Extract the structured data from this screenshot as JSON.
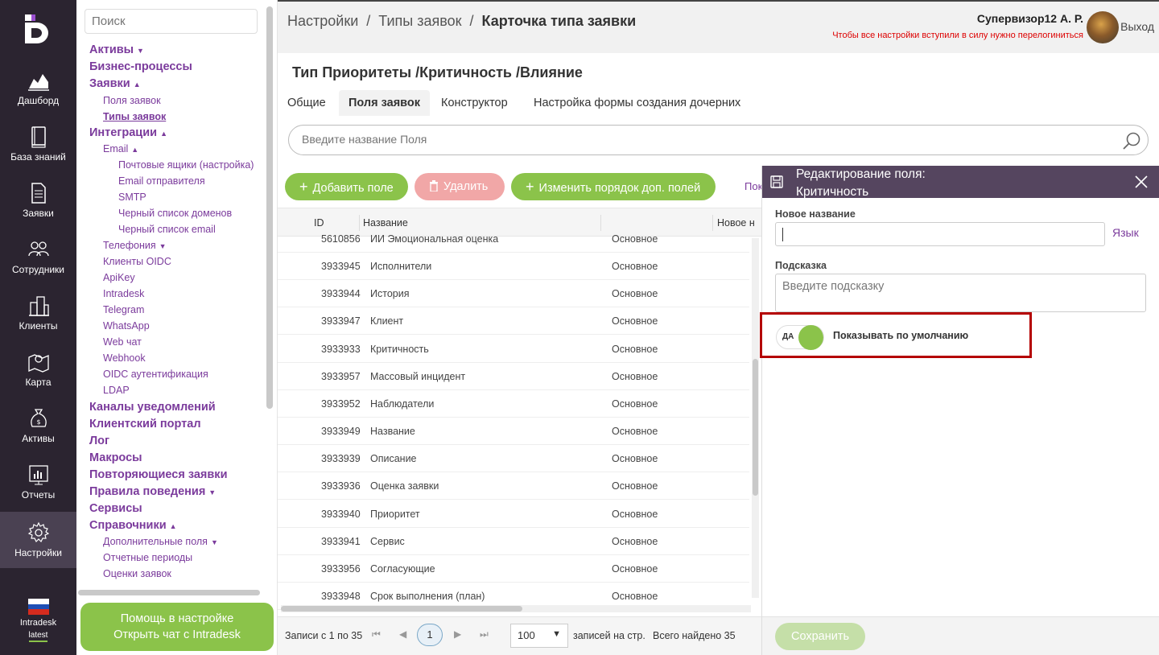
{
  "rail": {
    "items": [
      {
        "label": "Дашборд",
        "icon": "dashboard-icon"
      },
      {
        "label": "База знаний",
        "icon": "book-icon"
      },
      {
        "label": "Заявки",
        "icon": "document-icon"
      },
      {
        "label": "Сотрудники",
        "icon": "people-icon"
      },
      {
        "label": "Клиенты",
        "icon": "buildings-icon"
      },
      {
        "label": "Карта",
        "icon": "map-icon"
      },
      {
        "label": "Активы",
        "icon": "money-bag-icon"
      },
      {
        "label": "Отчеты",
        "icon": "report-icon"
      },
      {
        "label": "Настройки",
        "icon": "gear-icon"
      }
    ],
    "brand": "Intradesk",
    "version": "latest"
  },
  "sidebar": {
    "search_placeholder": "Поиск",
    "tree": [
      {
        "label": "Активы",
        "caret": "▼"
      },
      {
        "label": "Бизнес-процессы",
        "caret": ""
      },
      {
        "label": "Заявки",
        "caret": "▲"
      },
      {
        "label": "Поля заявок",
        "caret": ""
      },
      {
        "label": "Типы заявок",
        "caret": ""
      },
      {
        "label": "Интеграции",
        "caret": "▲"
      },
      {
        "label": "Email",
        "caret": "▲"
      },
      {
        "label": "Почтовые ящики (настройка)",
        "caret": ""
      },
      {
        "label": "Email отправителя",
        "caret": ""
      },
      {
        "label": "SMTP",
        "caret": ""
      },
      {
        "label": "Черный список доменов",
        "caret": ""
      },
      {
        "label": "Черный список email",
        "caret": ""
      },
      {
        "label": "Телефония",
        "caret": "▼"
      },
      {
        "label": "Клиенты OIDC",
        "caret": ""
      },
      {
        "label": "ApiKey",
        "caret": ""
      },
      {
        "label": "Intradesk",
        "caret": ""
      },
      {
        "label": "Telegram",
        "caret": ""
      },
      {
        "label": "WhatsApp",
        "caret": ""
      },
      {
        "label": "Web чат",
        "caret": ""
      },
      {
        "label": "Webhook",
        "caret": ""
      },
      {
        "label": "OIDC аутентификация",
        "caret": ""
      },
      {
        "label": "LDAP",
        "caret": ""
      },
      {
        "label": "Каналы уведомлений",
        "caret": ""
      },
      {
        "label": "Клиентский портал",
        "caret": ""
      },
      {
        "label": "Лог",
        "caret": ""
      },
      {
        "label": "Макросы",
        "caret": ""
      },
      {
        "label": "Повторяющиеся заявки",
        "caret": ""
      },
      {
        "label": "Правила поведения",
        "caret": "▼"
      },
      {
        "label": "Сервисы",
        "caret": ""
      },
      {
        "label": "Справочники",
        "caret": "▲"
      },
      {
        "label": "Дополнительные поля",
        "caret": "▼"
      },
      {
        "label": "Отчетные периоды",
        "caret": ""
      },
      {
        "label": "Оценки заявок",
        "caret": ""
      }
    ],
    "help_line1": "Помощь в настройке",
    "help_line2": "Открыть чат с Intradesk"
  },
  "header": {
    "crumb1": "Настройки",
    "crumb2": "Типы заявок",
    "crumb3": "Карточка типа заявки",
    "sep": "/",
    "user": "Супервизор12 А. Р.",
    "warning": "Чтобы все настройки вступили в силу нужно перелогиниться",
    "logout": "Выход"
  },
  "card": {
    "title": "Тип Приоритеты /Критичность /Влияние",
    "tabs": [
      "Общие",
      "Поля заявок",
      "Конструктор",
      "Настройка формы создания дочерних"
    ],
    "search_placeholder": "Введите название Поля",
    "btn_add": "Добавить поле",
    "btn_delete": "Удалить",
    "btn_order": "Изменить порядок доп. полей",
    "show_link": "Пока"
  },
  "grid": {
    "headers": {
      "id": "ID",
      "name": "Название",
      "new": "Новое н"
    },
    "rows": [
      {
        "id": "5610856",
        "name": "ИИ Эмоциональная оценка",
        "type": "Основное"
      },
      {
        "id": "3933945",
        "name": "Исполнители",
        "type": "Основное"
      },
      {
        "id": "3933944",
        "name": "История",
        "type": "Основное"
      },
      {
        "id": "3933947",
        "name": "Клиент",
        "type": "Основное"
      },
      {
        "id": "3933933",
        "name": "Критичность",
        "type": "Основное"
      },
      {
        "id": "3933957",
        "name": "Массовый инцидент",
        "type": "Основное"
      },
      {
        "id": "3933952",
        "name": "Наблюдатели",
        "type": "Основное"
      },
      {
        "id": "3933949",
        "name": "Название",
        "type": "Основное"
      },
      {
        "id": "3933939",
        "name": "Описание",
        "type": "Основное"
      },
      {
        "id": "3933936",
        "name": "Оценка заявки",
        "type": "Основное"
      },
      {
        "id": "3933940",
        "name": "Приоритет",
        "type": "Основное"
      },
      {
        "id": "3933941",
        "name": "Сервис",
        "type": "Основное"
      },
      {
        "id": "3933956",
        "name": "Согласующие",
        "type": "Основное"
      },
      {
        "id": "3933948",
        "name": "Срок выполнения (план)",
        "type": "Основное"
      }
    ]
  },
  "pager": {
    "range": "Записи с 1 по 35",
    "current": "1",
    "per_page": "100",
    "per_page_label": "записей на стр.",
    "total": "Всего найдено 35"
  },
  "panel": {
    "title_line1": "Редактирование поля:",
    "title_line2": "Критичность",
    "new_name_label": "Новое название",
    "lang": "Язык",
    "hint_label": "Подсказка",
    "hint_placeholder": "Введите подсказку",
    "toggle_state": "ДА",
    "toggle_label": "Показывать по умолчанию",
    "save": "Сохранить"
  }
}
